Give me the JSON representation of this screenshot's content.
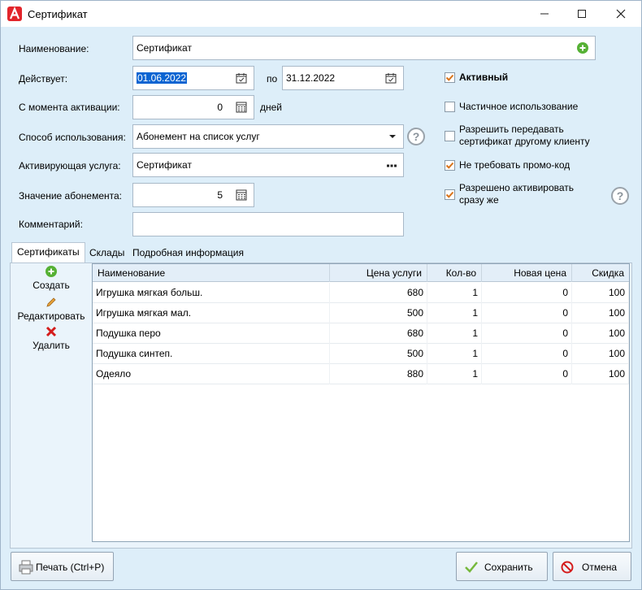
{
  "window": {
    "title": "Сертификат"
  },
  "form": {
    "name_label": "Наименование:",
    "name_value": "Сертификат",
    "valid_label": "Действует:",
    "date_from": "01.06.2022",
    "date_sep": "по",
    "date_to": "31.12.2022",
    "activation_label": "С момента активации:",
    "activation_value": "0",
    "activation_unit": "дней",
    "usage_label": "Способ использования:",
    "usage_value": "Абонемент на список услуг",
    "service_label": "Активирующая услуга:",
    "service_value": "Сертификат",
    "subscription_label": "Значение абонемента:",
    "subscription_value": "5",
    "comment_label": "Комментарий:",
    "comment_value": ""
  },
  "options": {
    "active": {
      "label": "Активный",
      "checked": true
    },
    "partial": {
      "label": "Частичное использование",
      "checked": false
    },
    "transfer": {
      "label1": "Разрешить передавать",
      "label2": "сертификат другому клиенту",
      "checked": false
    },
    "no_promo": {
      "label": "Не требовать промо-код",
      "checked": true
    },
    "activate_now": {
      "label1": "Разрешено активировать",
      "label2": "сразу же",
      "checked": true
    }
  },
  "tabs": [
    "Сертификаты",
    "Склады",
    "Подробная информация"
  ],
  "side_actions": {
    "create": "Создать",
    "edit": "Редактировать",
    "delete": "Удалить"
  },
  "table": {
    "headers": [
      "Наименование",
      "Цена услуги",
      "Кол-во",
      "Новая цена",
      "Скидка"
    ],
    "rows": [
      [
        "Игрушка мягкая больш.",
        "680",
        "1",
        "0",
        "100"
      ],
      [
        "Игрушка мягкая мал.",
        "500",
        "1",
        "0",
        "100"
      ],
      [
        "Подушка перо",
        "680",
        "1",
        "0",
        "100"
      ],
      [
        "Подушка синтеп.",
        "500",
        "1",
        "0",
        "100"
      ],
      [
        "Одеяло",
        "880",
        "1",
        "0",
        "100"
      ]
    ]
  },
  "buttons": {
    "print": "Печать (Ctrl+P)",
    "save": "Сохранить",
    "cancel": "Отмена"
  },
  "colors": {
    "accent": "#0a64d2",
    "checkbox": "#d8731a",
    "add": "#56b135",
    "delete": "#d41c1c",
    "background": "#ddeef9"
  }
}
